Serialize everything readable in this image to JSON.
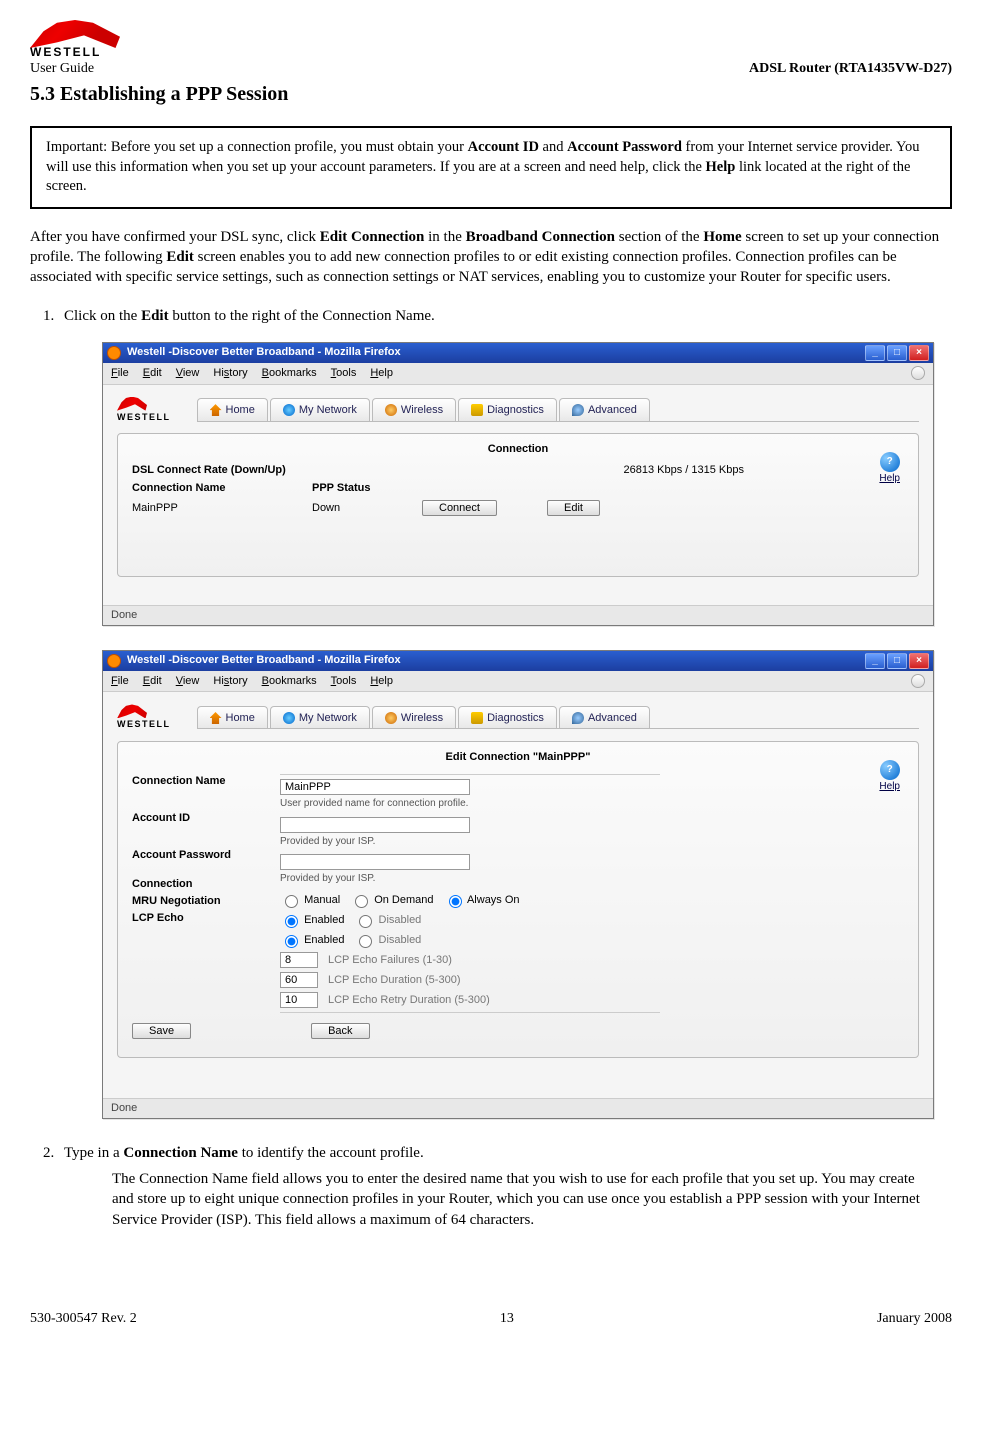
{
  "logo_text": "WESTELL",
  "doc_left": "User Guide",
  "doc_right": "ADSL Router (RTA1435VW-D27)",
  "section_title": "5.3 Establishing a PPP Session",
  "callout": {
    "prefix": "Important: Before you set up a connection profile, you must obtain your ",
    "acct_id": "Account ID",
    "mid1": " and ",
    "acct_pw": "Account Password",
    "after1": " from your Internet service provider. You will use this information when you set up your account parameters. If you are at a screen and need help, click the ",
    "help": "Help",
    "after2": " link located at the right of the screen."
  },
  "para1": {
    "t1": "After you have confirmed your DSL sync, click ",
    "b1": "Edit Connection",
    "t2": " in the ",
    "b2": "Broadband Connection",
    "t3": " section of the ",
    "b3": "Home",
    "t4": " screen to set up your connection profile. The following ",
    "b4": "Edit",
    "t5": " screen enables you to add new connection profiles to or edit existing connection profiles. Connection profiles can be associated with specific service settings, such as connection settings or NAT services, enabling you to customize your Router for specific users."
  },
  "step1": {
    "pre": "Click on the ",
    "bold": "Edit",
    "post": " button to the right of the Connection Name."
  },
  "step2": {
    "pre": "Type in a ",
    "bold": "Connection Name",
    "post": " to identify the account profile.",
    "sub": "The Connection Name field allows you to enter the desired name that you wish to use for each profile that you set up. You may create and store up to eight unique connection profiles in your Router, which you can use once you establish a PPP session with your Internet Service Provider (ISP). This field allows a maximum of 64 characters."
  },
  "window_common": {
    "title": "Westell -Discover Better Broadband - Mozilla Firefox",
    "menu": {
      "file": "File",
      "edit": "Edit",
      "view": "View",
      "history": "History",
      "bookmarks": "Bookmarks",
      "tools": "Tools",
      "help": "Help"
    },
    "tabs": [
      "Home",
      "My Network",
      "Wireless",
      "Diagnostics",
      "Advanced"
    ],
    "help_label": "Help",
    "status": "Done"
  },
  "shot1": {
    "panel_title": "Connection",
    "dsl_rate_label": "DSL Connect Rate (Down/Up)",
    "dsl_rate_value": "26813 Kbps / 1315 Kbps",
    "conn_name_label": "Connection Name",
    "ppp_status_label": "PPP Status",
    "conn_name_value": "MainPPP",
    "ppp_status_value": "Down",
    "connect_btn": "Connect",
    "edit_btn": "Edit"
  },
  "shot2": {
    "panel_title": "Edit Connection \"MainPPP\"",
    "labels": {
      "conn_name": "Connection Name",
      "acct_id": "Account ID",
      "acct_pw": "Account Password",
      "connection": "Connection",
      "mru": "MRU Negotiation",
      "lcp": "LCP Echo"
    },
    "values": {
      "conn_name": "MainPPP",
      "acct_id": "",
      "acct_pw": ""
    },
    "hints": {
      "conn_name": "User provided name for connection profile.",
      "acct_id": "Provided by your ISP.",
      "acct_pw": "Provided by your ISP."
    },
    "radios": {
      "manual": "Manual",
      "ondemand": "On Demand",
      "always": "Always On",
      "enabled": "Enabled",
      "disabled": "Disabled"
    },
    "lcp": {
      "failures": "8",
      "failures_hint": "LCP Echo Failures (1-30)",
      "duration": "60",
      "duration_hint": "LCP Echo Duration (5-300)",
      "retry": "10",
      "retry_hint": "LCP Echo Retry Duration (5-300)"
    },
    "save_btn": "Save",
    "back_btn": "Back"
  },
  "footer": {
    "left": "530-300547 Rev. 2",
    "center": "13",
    "right": "January 2008"
  }
}
